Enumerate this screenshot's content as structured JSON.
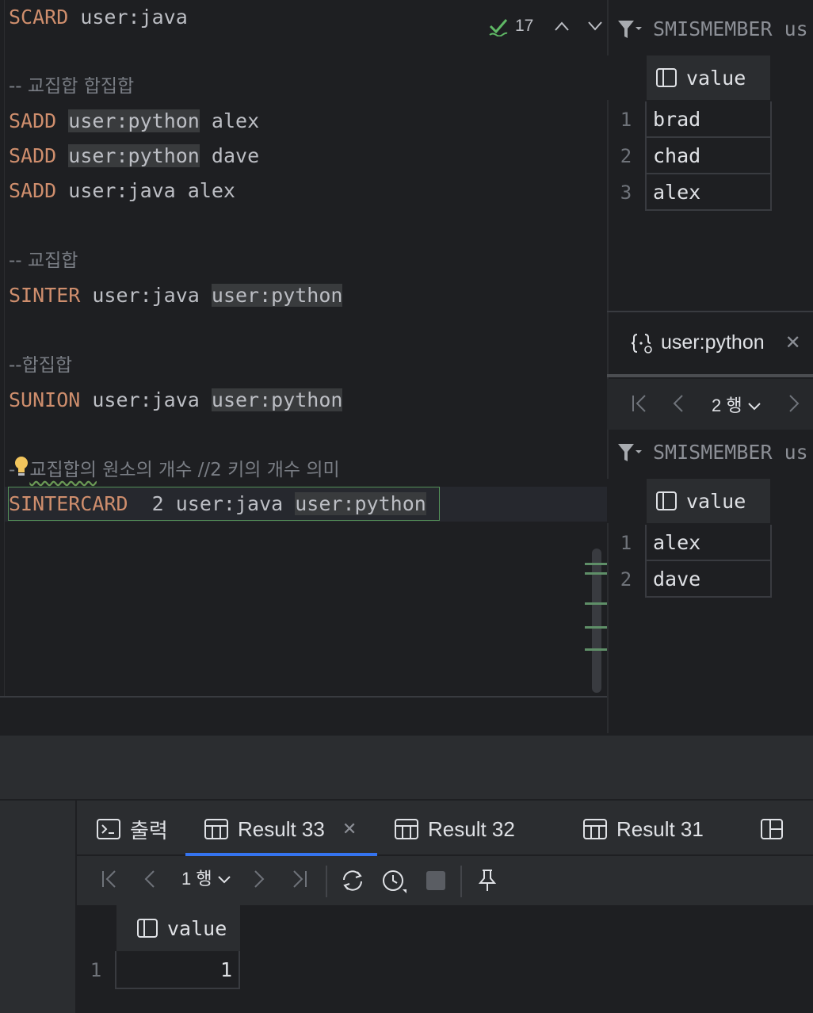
{
  "editor": {
    "lines": [
      {
        "kw": "SCARD",
        "rest": " user:java"
      },
      {
        "comment": "-- 교집합 합집합"
      },
      {
        "kw": "SADD",
        "sp": " ",
        "hl": "user:python",
        "rest": " alex"
      },
      {
        "kw": "SADD",
        "sp": " ",
        "hl": "user:python",
        "rest": " dave"
      },
      {
        "kw": "SADD",
        "rest": " user:java alex"
      },
      {
        "comment": "-- 교집합"
      },
      {
        "kw": "SINTER",
        "rest": " user:java ",
        "hl": "user:python"
      },
      {
        "comment": "--합집합"
      },
      {
        "kw": "SUNION",
        "rest": " user:java ",
        "hl": "user:python"
      },
      {
        "comment_prefix": "-",
        "comment_squig": "교집합의",
        "comment_rest": " 원소의 개수 //2 키의 개수 의미"
      },
      {
        "kw": "SINTERCARD",
        "rest": "  2 user:java ",
        "hl": "user:python"
      }
    ],
    "inspection_count": "17",
    "colors": {
      "keyword": "#cf8e6d",
      "comment": "#7a7e85",
      "check": "#5fb865"
    }
  },
  "right_panel": {
    "top": {
      "filter_text": "SMISMEMBER us",
      "column": "value",
      "rows": [
        {
          "n": "1",
          "v": "brad"
        },
        {
          "n": "2",
          "v": "chad"
        },
        {
          "n": "3",
          "v": "alex"
        }
      ]
    },
    "python_tab": {
      "label": "user:python",
      "close": "✕"
    },
    "pager": {
      "rows_label": "2 행"
    },
    "bottom": {
      "filter_text": "SMISMEMBER us",
      "column": "value",
      "rows": [
        {
          "n": "1",
          "v": "alex"
        },
        {
          "n": "2",
          "v": "dave"
        }
      ]
    }
  },
  "bottom_panel": {
    "tabs": [
      {
        "label": "출력",
        "icon": "console-icon"
      },
      {
        "label": "Result 33",
        "icon": "table-icon",
        "active": true,
        "close": "✕"
      },
      {
        "label": "Result 32",
        "icon": "table-icon"
      },
      {
        "label": "Result 31",
        "icon": "table-icon"
      }
    ],
    "toolbar": {
      "rows_label": "1 행"
    },
    "grid": {
      "column": "value",
      "row_num": "1",
      "value": "1"
    },
    "accent": "#3574f0"
  }
}
